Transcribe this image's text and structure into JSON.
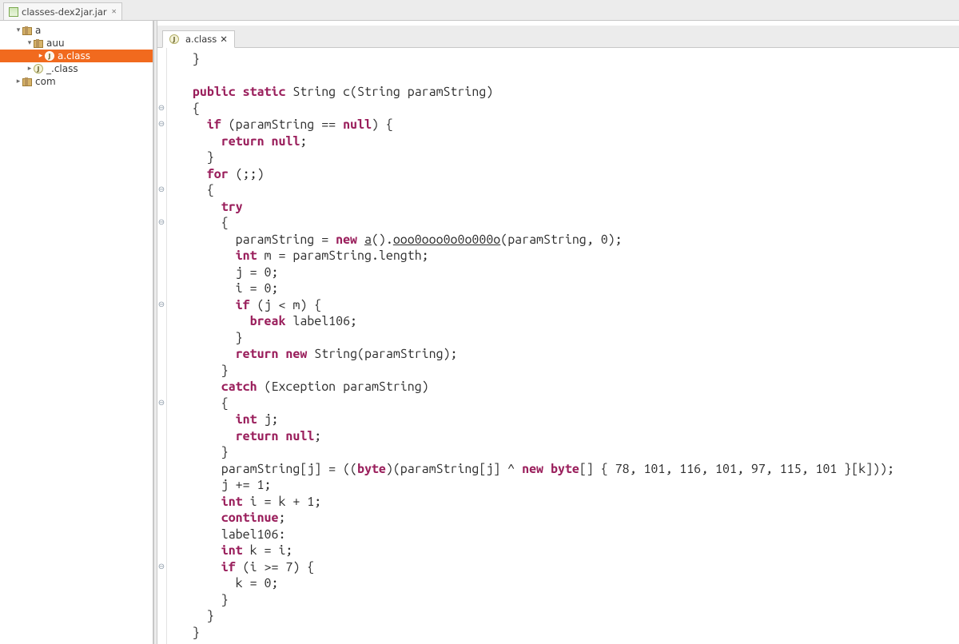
{
  "topTab": {
    "label": "classes-dex2jar.jar"
  },
  "tree": {
    "nodes": [
      {
        "indent": 1,
        "arrow": "▾",
        "type": "pkg",
        "label": "a",
        "selected": false
      },
      {
        "indent": 2,
        "arrow": "▾",
        "type": "pkg",
        "label": "auu",
        "selected": false
      },
      {
        "indent": 3,
        "arrow": "▸",
        "type": "cls",
        "label": "a.class",
        "selected": true
      },
      {
        "indent": 2,
        "arrow": "▸",
        "type": "cls",
        "label": "_.class",
        "selected": false
      },
      {
        "indent": 1,
        "arrow": "▸",
        "type": "pkg",
        "label": "com",
        "selected": false
      }
    ]
  },
  "editorTab": {
    "label": "a.class"
  },
  "code": {
    "lines": [
      {
        "fold": false,
        "tokens": [
          {
            "t": "  }",
            "k": ""
          }
        ]
      },
      {
        "fold": false,
        "tokens": [
          {
            "t": "  ",
            "k": ""
          }
        ]
      },
      {
        "fold": false,
        "tokens": [
          {
            "t": "  ",
            "k": ""
          },
          {
            "t": "public",
            "k": "kw"
          },
          {
            "t": " ",
            "k": ""
          },
          {
            "t": "static",
            "k": "kw"
          },
          {
            "t": " String c(String paramString)",
            "k": ""
          }
        ]
      },
      {
        "fold": true,
        "tokens": [
          {
            "t": "  {",
            "k": ""
          }
        ]
      },
      {
        "fold": true,
        "tokens": [
          {
            "t": "    ",
            "k": ""
          },
          {
            "t": "if",
            "k": "kw"
          },
          {
            "t": " (paramString == ",
            "k": ""
          },
          {
            "t": "null",
            "k": "kw"
          },
          {
            "t": ") {",
            "k": ""
          }
        ]
      },
      {
        "fold": false,
        "tokens": [
          {
            "t": "      ",
            "k": ""
          },
          {
            "t": "return",
            "k": "kw"
          },
          {
            "t": " ",
            "k": ""
          },
          {
            "t": "null",
            "k": "kw"
          },
          {
            "t": ";",
            "k": ""
          }
        ]
      },
      {
        "fold": false,
        "tokens": [
          {
            "t": "    }",
            "k": ""
          }
        ]
      },
      {
        "fold": false,
        "tokens": [
          {
            "t": "    ",
            "k": ""
          },
          {
            "t": "for",
            "k": "kw"
          },
          {
            "t": " (;;)",
            "k": ""
          }
        ]
      },
      {
        "fold": true,
        "tokens": [
          {
            "t": "    {",
            "k": ""
          }
        ]
      },
      {
        "fold": false,
        "tokens": [
          {
            "t": "      ",
            "k": ""
          },
          {
            "t": "try",
            "k": "kw"
          }
        ]
      },
      {
        "fold": true,
        "tokens": [
          {
            "t": "      {",
            "k": ""
          }
        ]
      },
      {
        "fold": false,
        "tokens": [
          {
            "t": "        paramString = ",
            "k": ""
          },
          {
            "t": "new",
            "k": "kw"
          },
          {
            "t": " ",
            "k": ""
          },
          {
            "t": "a",
            "k": "und"
          },
          {
            "t": "().",
            "k": ""
          },
          {
            "t": "ooo0ooo0o0o000o",
            "k": "und"
          },
          {
            "t": "(paramString, 0);",
            "k": ""
          }
        ]
      },
      {
        "fold": false,
        "tokens": [
          {
            "t": "        ",
            "k": ""
          },
          {
            "t": "int",
            "k": "kw"
          },
          {
            "t": " m = paramString.length;",
            "k": ""
          }
        ]
      },
      {
        "fold": false,
        "tokens": [
          {
            "t": "        j = 0;",
            "k": ""
          }
        ]
      },
      {
        "fold": false,
        "tokens": [
          {
            "t": "        i = 0;",
            "k": ""
          }
        ]
      },
      {
        "fold": true,
        "tokens": [
          {
            "t": "        ",
            "k": ""
          },
          {
            "t": "if",
            "k": "kw"
          },
          {
            "t": " (j < m) {",
            "k": ""
          }
        ]
      },
      {
        "fold": false,
        "tokens": [
          {
            "t": "          ",
            "k": ""
          },
          {
            "t": "break",
            "k": "kw"
          },
          {
            "t": " label106;",
            "k": ""
          }
        ]
      },
      {
        "fold": false,
        "tokens": [
          {
            "t": "        }",
            "k": ""
          }
        ]
      },
      {
        "fold": false,
        "tokens": [
          {
            "t": "        ",
            "k": ""
          },
          {
            "t": "return",
            "k": "kw"
          },
          {
            "t": " ",
            "k": ""
          },
          {
            "t": "new",
            "k": "kw"
          },
          {
            "t": " String(paramString);",
            "k": ""
          }
        ]
      },
      {
        "fold": false,
        "tokens": [
          {
            "t": "      }",
            "k": ""
          }
        ]
      },
      {
        "fold": false,
        "tokens": [
          {
            "t": "      ",
            "k": ""
          },
          {
            "t": "catch",
            "k": "kw"
          },
          {
            "t": " (Exception paramString)",
            "k": ""
          }
        ]
      },
      {
        "fold": true,
        "tokens": [
          {
            "t": "      {",
            "k": ""
          }
        ]
      },
      {
        "fold": false,
        "tokens": [
          {
            "t": "        ",
            "k": ""
          },
          {
            "t": "int",
            "k": "kw"
          },
          {
            "t": " j;",
            "k": ""
          }
        ]
      },
      {
        "fold": false,
        "tokens": [
          {
            "t": "        ",
            "k": ""
          },
          {
            "t": "return",
            "k": "kw"
          },
          {
            "t": " ",
            "k": ""
          },
          {
            "t": "null",
            "k": "kw"
          },
          {
            "t": ";",
            "k": ""
          }
        ]
      },
      {
        "fold": false,
        "tokens": [
          {
            "t": "      }",
            "k": ""
          }
        ]
      },
      {
        "fold": false,
        "tokens": [
          {
            "t": "      paramString[j] = ((",
            "k": ""
          },
          {
            "t": "byte",
            "k": "kw"
          },
          {
            "t": ")(paramString[j] ^ ",
            "k": ""
          },
          {
            "t": "new",
            "k": "kw"
          },
          {
            "t": " ",
            "k": ""
          },
          {
            "t": "byte",
            "k": "kw"
          },
          {
            "t": "[] { 78, 101, 116, 101, 97, 115, 101 }[k]));",
            "k": ""
          }
        ]
      },
      {
        "fold": false,
        "tokens": [
          {
            "t": "      j += 1;",
            "k": ""
          }
        ]
      },
      {
        "fold": false,
        "tokens": [
          {
            "t": "      ",
            "k": ""
          },
          {
            "t": "int",
            "k": "kw"
          },
          {
            "t": " i = k + 1;",
            "k": ""
          }
        ]
      },
      {
        "fold": false,
        "tokens": [
          {
            "t": "      ",
            "k": ""
          },
          {
            "t": "continue",
            "k": "kw"
          },
          {
            "t": ";",
            "k": ""
          }
        ]
      },
      {
        "fold": false,
        "tokens": [
          {
            "t": "      label106:",
            "k": ""
          }
        ]
      },
      {
        "fold": false,
        "tokens": [
          {
            "t": "      ",
            "k": ""
          },
          {
            "t": "int",
            "k": "kw"
          },
          {
            "t": " k = i;",
            "k": ""
          }
        ]
      },
      {
        "fold": true,
        "tokens": [
          {
            "t": "      ",
            "k": ""
          },
          {
            "t": "if",
            "k": "kw"
          },
          {
            "t": " (i >= 7) {",
            "k": ""
          }
        ]
      },
      {
        "fold": false,
        "tokens": [
          {
            "t": "        k = 0;",
            "k": ""
          }
        ]
      },
      {
        "fold": false,
        "tokens": [
          {
            "t": "      }",
            "k": ""
          }
        ]
      },
      {
        "fold": false,
        "tokens": [
          {
            "t": "    }",
            "k": ""
          }
        ]
      },
      {
        "fold": false,
        "tokens": [
          {
            "t": "  }",
            "k": ""
          }
        ]
      }
    ]
  }
}
